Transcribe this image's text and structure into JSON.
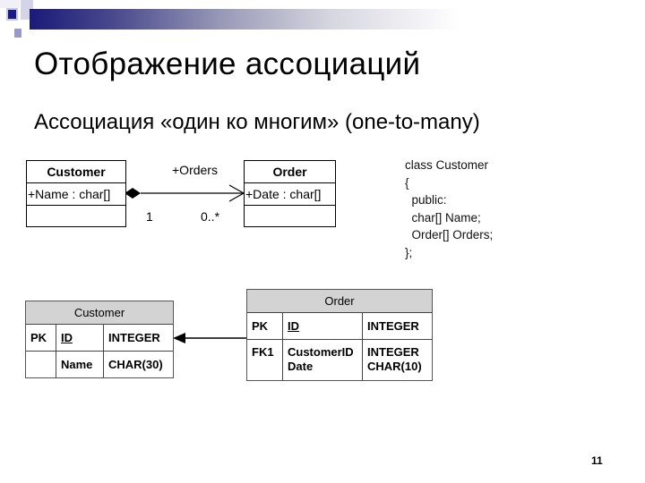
{
  "slide": {
    "title": "Отображение ассоциаций",
    "subtitle": "Ассоциация «один ко многим» (one-to-many)",
    "page_number": "11"
  },
  "uml": {
    "customer": {
      "name": "Customer",
      "attribute": "+Name : char[]"
    },
    "order": {
      "name": "Order",
      "attribute": "+Date : char[]"
    },
    "association": {
      "role": "+Orders",
      "multiplicity_source": "1",
      "multiplicity_target": "0..*",
      "source_end": "composition-diamond",
      "target_end": "open-arrow"
    }
  },
  "code": {
    "lines": [
      "class Customer",
      "{",
      "  public:",
      "  char[] Name;",
      "  Order[] Orders;",
      "};"
    ]
  },
  "er": {
    "customer": {
      "name": "Customer",
      "rows": [
        {
          "key": "PK",
          "column": "ID",
          "type": "INTEGER"
        },
        {
          "key": "",
          "column": "Name",
          "type": "CHAR(30)"
        }
      ]
    },
    "order": {
      "name": "Order",
      "rows": [
        {
          "key": "PK",
          "column": "ID",
          "type": "INTEGER"
        },
        {
          "key": "FK1",
          "column": "CustomerID",
          "type": "INTEGER",
          "column2": "Date",
          "type2": "CHAR(10)"
        }
      ]
    }
  }
}
